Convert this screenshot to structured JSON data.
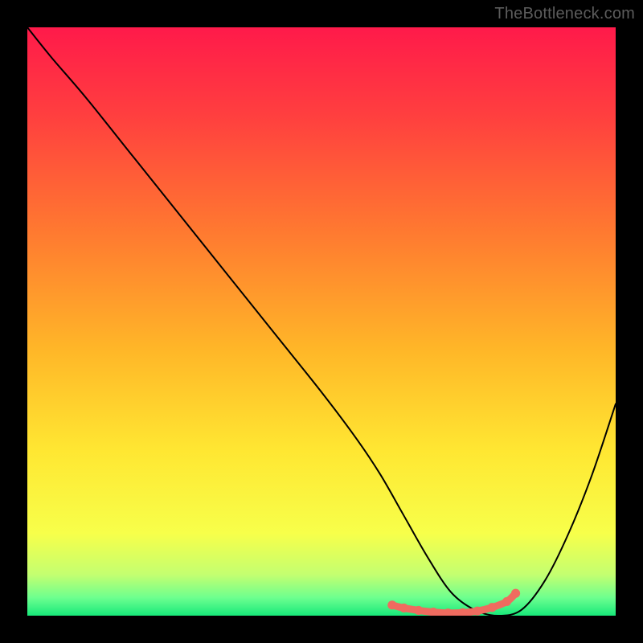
{
  "watermark": "TheBottleneck.com",
  "chart_data": {
    "type": "line",
    "title": "",
    "xlabel": "",
    "ylabel": "",
    "xlim": [
      0,
      100
    ],
    "ylim": [
      0,
      100
    ],
    "background_gradient": {
      "type": "vertical",
      "stops": [
        {
          "pos": 0.0,
          "color": "#ff1a4a"
        },
        {
          "pos": 0.15,
          "color": "#ff3f3f"
        },
        {
          "pos": 0.35,
          "color": "#ff7a30"
        },
        {
          "pos": 0.55,
          "color": "#ffb728"
        },
        {
          "pos": 0.72,
          "color": "#ffe732"
        },
        {
          "pos": 0.86,
          "color": "#f7ff4a"
        },
        {
          "pos": 0.93,
          "color": "#c4ff70"
        },
        {
          "pos": 0.97,
          "color": "#6cff8f"
        },
        {
          "pos": 1.0,
          "color": "#17e87a"
        }
      ]
    },
    "series": [
      {
        "name": "bottleneck-curve",
        "stroke": "#000000",
        "stroke_width": 2,
        "x": [
          0,
          4,
          10,
          18,
          26,
          34,
          42,
          50,
          56,
          60,
          64,
          68,
          72,
          76,
          80,
          84,
          88,
          92,
          96,
          100
        ],
        "y": [
          100,
          95,
          88,
          78,
          68,
          58,
          48,
          38,
          30,
          24,
          17,
          10,
          4,
          1,
          0,
          1,
          6,
          14,
          24,
          36
        ]
      }
    ],
    "marker_segment": {
      "name": "optimal-zone",
      "color": "#ef6b5f",
      "stroke_width": 9,
      "x": [
        62,
        64,
        66.5,
        69,
        71.5,
        74,
        76.5,
        79,
        81.5,
        83
      ],
      "y": [
        1.8,
        1.3,
        0.9,
        0.6,
        0.45,
        0.5,
        0.8,
        1.4,
        2.4,
        3.8
      ]
    }
  }
}
